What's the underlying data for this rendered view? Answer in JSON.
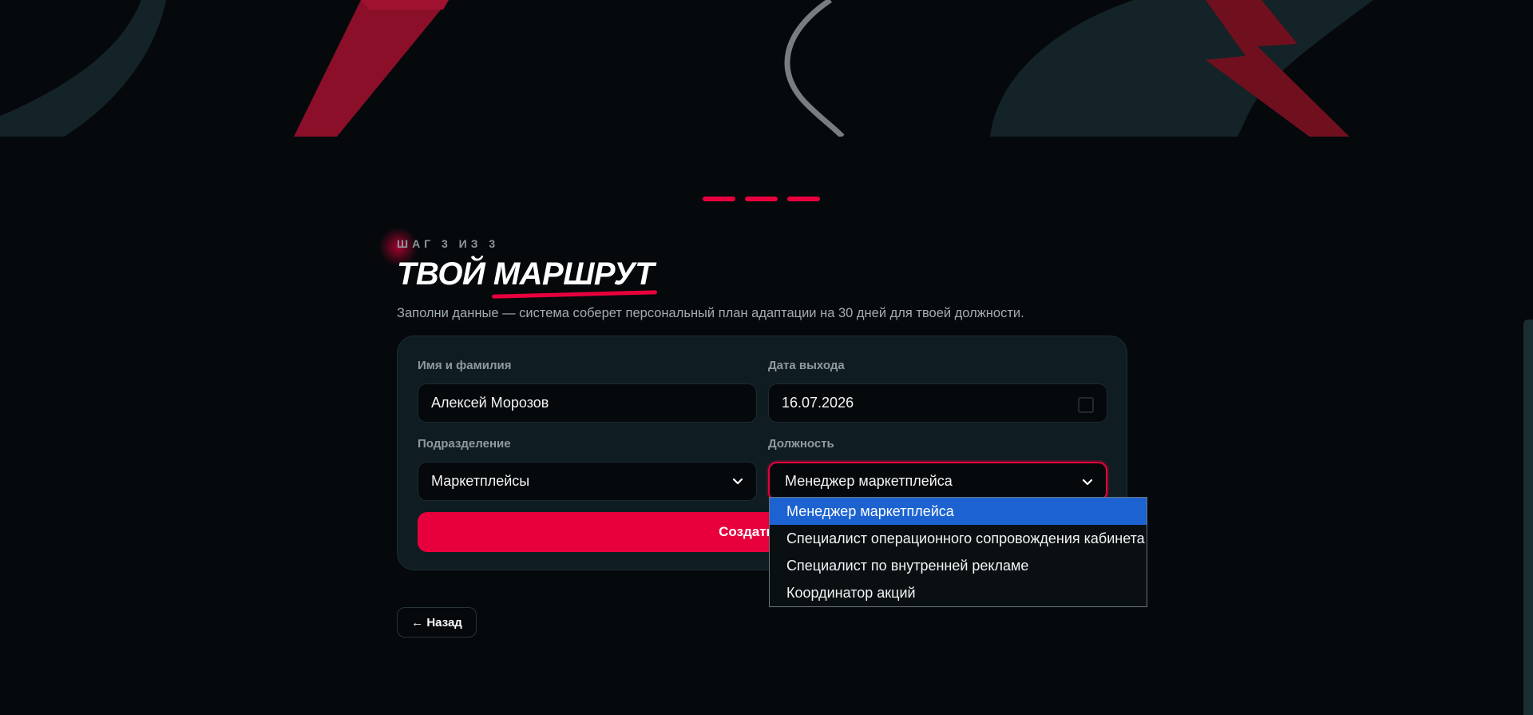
{
  "step_label": "ШАГ 3 ИЗ 3",
  "title": {
    "part1": "ТВОЙ ",
    "accent": "МАРШРУТ"
  },
  "subtitle": "Заполни данные — система соберет персональный план адаптации на 30 дней для твоей должности.",
  "form": {
    "name_label": "Имя и фамилия",
    "name_value": "Алексей Морозов",
    "date_label": "Дата выхода",
    "date_value": "16.07.2026",
    "department_label": "Подразделение",
    "department_value": "Маркетплейсы",
    "position_label": "Должность",
    "position_value": "Менеджер маркетплейса",
    "submit_label": "Создать мой",
    "position_options": [
      "Менеджер маркетплейса",
      "Специалист операционного сопровождения кабинета",
      "Специалист по внутренней рекламе",
      "Координатор акций"
    ]
  },
  "back_label": "← Назад",
  "progress_steps": 3,
  "colors": {
    "accent": "#e8003d",
    "background": "#05090c",
    "card": "#0f1d22",
    "selected_option": "#1c63d1"
  },
  "icons": [
    "chevron-down-icon",
    "calendar-icon"
  ]
}
